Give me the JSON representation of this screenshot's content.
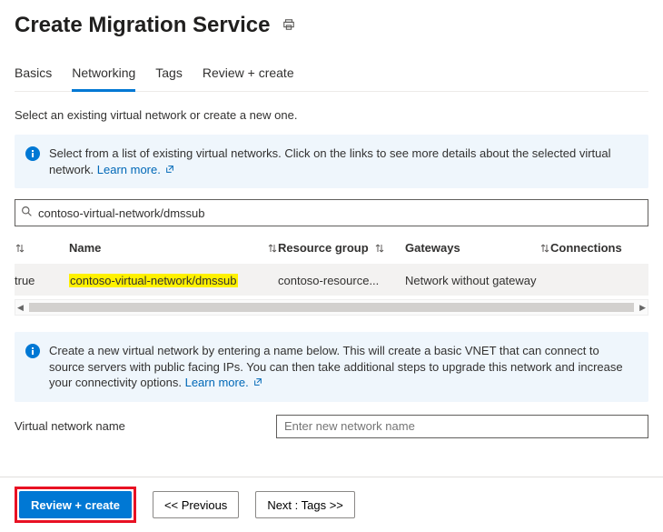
{
  "header": {
    "title": "Create Migration Service"
  },
  "tabs": [
    "Basics",
    "Networking",
    "Tags",
    "Review + create"
  ],
  "activeTab": 1,
  "description": "Select an existing virtual network or create a new one.",
  "info1": {
    "text": "Select from a list of existing virtual networks. Click on the links to see more details about the selected virtual network.",
    "link": "Learn more."
  },
  "search": {
    "value": "contoso-virtual-network/dmssub"
  },
  "columns": [
    "",
    "Name",
    "Resource group",
    "Gateways",
    "Connections"
  ],
  "row": {
    "sel": "true",
    "name": "contoso-virtual-network/dmssub",
    "rg": "contoso-resource...",
    "gw": "Network without gateway"
  },
  "info2": {
    "text": "Create a new virtual network by entering a name below. This will create a basic VNET that can connect to source servers with public facing IPs. You can then take additional steps to upgrade this network and increase your connectivity options.",
    "link": "Learn more."
  },
  "form": {
    "label": "Virtual network name",
    "placeholder": "Enter new network name"
  },
  "footer": {
    "primary": "Review + create",
    "prev": "<< Previous",
    "next": "Next : Tags >>"
  }
}
